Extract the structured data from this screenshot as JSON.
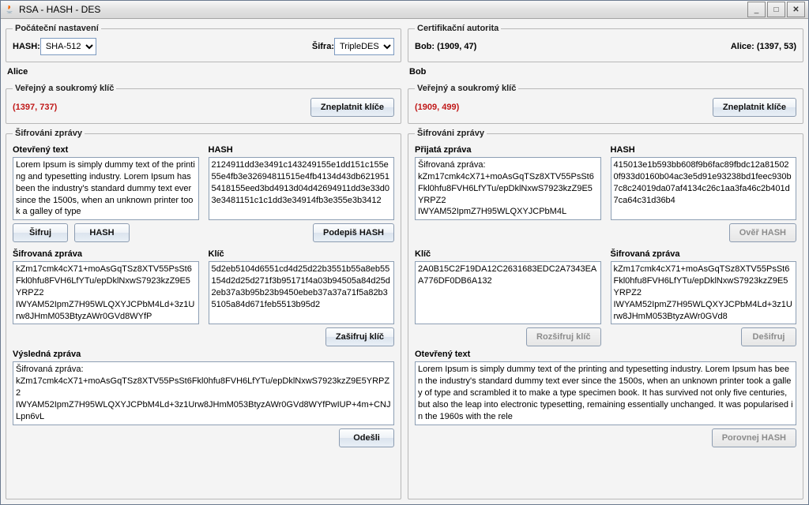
{
  "window": {
    "title": "RSA - HASH - DES"
  },
  "win_buttons": {
    "min": "_",
    "max": "□",
    "close": "✕"
  },
  "settings": {
    "legend": "Počáteční nastavení",
    "hash_label": "HASH:",
    "hash_value": "SHA-512",
    "cipher_label": "Šifra:",
    "cipher_value": "TripleDES"
  },
  "ca": {
    "legend": "Certifikační autorita",
    "bob_label": "Bob:",
    "bob_value": "(1909, 47)",
    "alice_label": "Alice:",
    "alice_value": "(1397, 53)"
  },
  "alice": {
    "panel": "Alice",
    "keys_legend": "Veřejný a soukromý klíč",
    "keys_value": "(1397, 737)",
    "invalidate_btn": "Zneplatnit klíče",
    "encrypt_legend": "Šifrováni zprávy",
    "plain_label": "Otevřený text",
    "plain_text": "Lorem Ipsum is simply dummy text of the printing and typesetting industry. Lorem Ipsum has been the industry's standard dummy text ever since the 1500s, when an unknown printer took a galley of type",
    "hash_label": "HASH",
    "hash_text": "2124911dd3e3491c143249155e1dd151c155e55e4fb3e32694811515e4fb4134d43db6219515418155eed3bd4913d04d42694911dd3e33d03e3481151c1c1dd3e34914fb3e355e3b3412",
    "encrypt_btn": "Šifruj",
    "hash_btn": "HASH",
    "sign_btn": "Podepiš HASH",
    "ciphertext_label": "Šifrovaná zpráva",
    "ciphertext_text": "kZm17cmk4cX71+moAsGqTSz8XTV55PsSt6Fkl0hfu8FVH6LfYTu/epDklNxwS7923kzZ9E5YRPZ2\nIWYAM52IpmZ7H95WLQXYJCPbM4Ld+3z1Urw8JHmM053BtyzAWr0GVd8WYfP",
    "key_label": "Klíč",
    "key_text": "5d2eb5104d6551cd4d25d22b3551b55a8eb55154d2d25d271f3b95171f4a03b94505a84d25d2eb37a3b95b23b9450ebeb37a37a71f5a82b35105a84d671feb5513b95d2",
    "encrypt_key_btn": "Zašifruj klíč",
    "result_label": "Výsledná zpráva",
    "result_text": "Šifrovaná zpráva:\nkZm17cmk4cX71+moAsGqTSz8XTV55PsSt6Fkl0hfu8FVH6LfYTu/epDklNxwS7923kzZ9E5YRPZ2\nIWYAM52IpmZ7H95WLQXYJCPbM4Ld+3z1Urw8JHmM053BtyzAWr0GVd8WYfPwIUP+4m+CNJLpn6vL",
    "send_btn": "Odešli"
  },
  "bob": {
    "panel": "Bob",
    "keys_legend": "Veřejný a soukromý klíč",
    "keys_value": "(1909, 499)",
    "invalidate_btn": "Zneplatnit klíče",
    "encrypt_legend": "Šifrováni zprávy",
    "received_label": "Přijatá zpráva",
    "received_text": "Šifrovaná zpráva:\nkZm17cmk4cX71+moAsGqTSz8XTV55PsSt6Fkl0hfu8FVH6LfYTu/epDklNxwS7923kzZ9E5YRPZ2\nIWYAM52IpmZ7H95WLQXYJCPbM4L",
    "hash_label": "HASH",
    "hash_text": "415013e1b593bb608f9b6fac89fbdc12a815020f933d0160b04ac3e5d91e93238bd1feec930b7c8c24019da07af4134c26c1aa3fa46c2b401d7ca64c31d36b4",
    "verify_btn": "Ověř HASH",
    "key_label": "Klíč",
    "key_text": "2A0B15C2F19DA12C2631683EDC2A7343EAA776DF0DB6A132",
    "ciphertext_label": "Šifrovaná zpráva",
    "ciphertext_text": "kZm17cmk4cX71+moAsGqTSz8XTV55PsSt6Fkl0hfu8FVH6LfYTu/epDklNxwS7923kzZ9E5YRPZ2\nIWYAM52IpmZ7H95WLQXYJCPbM4Ld+3z1Urw8JHmM053BtyzAWr0GVd8",
    "decrypt_key_btn": "Rozšifruj klíč",
    "decrypt_btn": "Dešifruj",
    "plain_label": "Otevřený text",
    "plain_text": "Lorem Ipsum is simply dummy text of the printing and typesetting industry. Lorem Ipsum has been the industry's standard dummy text ever since the 1500s, when an unknown printer took a galley of type and scrambled it to make a type specimen book. It has survived not only five centuries, but also the leap into electronic typesetting, remaining essentially unchanged. It was popularised in the 1960s with the rele",
    "compare_btn": "Porovnej HASH"
  }
}
